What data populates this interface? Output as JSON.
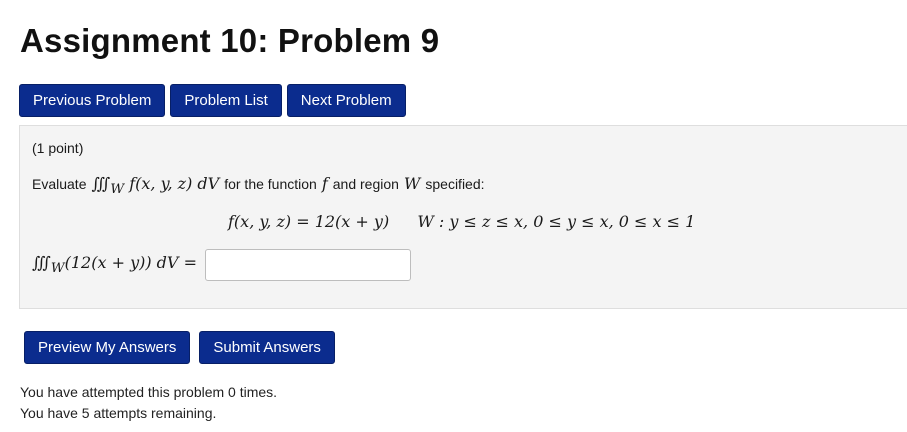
{
  "page": {
    "title": "Assignment 10: Problem 9"
  },
  "nav": {
    "previous": "Previous Problem",
    "list": "Problem List",
    "next": "Next Problem"
  },
  "problem": {
    "points": "(1 point)",
    "prompt_before": "Evaluate",
    "prompt_integral": "∭",
    "prompt_region_sub": "W",
    "prompt_integrand": "f(x, y, z) dV",
    "prompt_middle1": "for the function",
    "prompt_f": "f",
    "prompt_middle2": "and region",
    "prompt_W": "W",
    "prompt_after": "specified:",
    "function_def": "f(x, y, z) = 12(x + y)",
    "region_def": "W : y ≤ z ≤ x, 0 ≤ y ≤ x, 0 ≤ x ≤ 1",
    "answer_integral": "∭",
    "answer_region_sub": "W",
    "answer_integrand": "(12(x + y)) dV =",
    "answer_value": ""
  },
  "actions": {
    "preview": "Preview My Answers",
    "submit": "Submit Answers"
  },
  "status": {
    "attempted": "You have attempted this problem 0 times.",
    "remaining": "You have 5 attempts remaining."
  },
  "colors": {
    "button_bg": "#0b2c8e",
    "button_text": "#ffffff",
    "panel_bg": "#f4f4f4"
  }
}
